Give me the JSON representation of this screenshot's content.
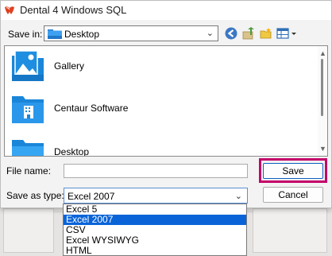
{
  "window": {
    "title": "Dental 4 Windows SQL"
  },
  "save_in": {
    "label": "Save in:",
    "value": "Desktop"
  },
  "toolbar": {
    "icons": [
      "back-arrow-icon",
      "up-folder-icon",
      "new-folder-icon",
      "view-menu-icon"
    ]
  },
  "file_list": {
    "items": [
      {
        "name": "Gallery",
        "icon": "gallery-folder-icon"
      },
      {
        "name": "Centaur Software",
        "icon": "building-folder-icon"
      },
      {
        "name": "Desktop",
        "icon": "desktop-folder-icon"
      }
    ]
  },
  "file_name": {
    "label": "File name:",
    "value": ""
  },
  "save_as_type": {
    "label": "Save as type:",
    "selected": "Excel 2007",
    "options": [
      "Excel 5",
      "Excel 2007",
      "CSV",
      "Excel WYSIWYG",
      "HTML"
    ],
    "selected_index": 1
  },
  "buttons": {
    "save": "Save",
    "cancel": "Cancel"
  },
  "colors": {
    "highlight": "#c4006a",
    "selection": "#0a64d8",
    "folder_blue": "#1a86d9"
  }
}
